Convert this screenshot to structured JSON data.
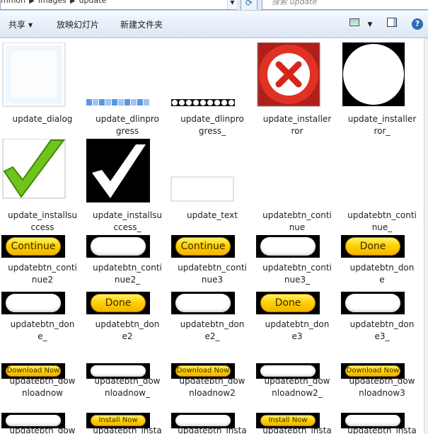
{
  "address": {
    "segments": [
      "mmon",
      "images",
      "update"
    ],
    "search_placeholder": "搜索 update"
  },
  "toolbar": {
    "share_label": "共享",
    "slideshow_label": "放映幻灯片",
    "new_folder_label": "新建文件夹",
    "help_label": "?"
  },
  "files": [
    {
      "name": "update_dialog",
      "thumb": "dialog"
    },
    {
      "name": "update_dlinprogress",
      "thumb": "progress-blue"
    },
    {
      "name": "update_dlinprogress_",
      "thumb": "progress-dots"
    },
    {
      "name": "update_installerror",
      "thumb": "error-red"
    },
    {
      "name": "update_installerror_",
      "thumb": "error-mask"
    },
    {
      "name": "update_installsuccess",
      "thumb": "success-green"
    },
    {
      "name": "update_installsuccess_",
      "thumb": "success-mask"
    },
    {
      "name": "update_text",
      "thumb": "text-box"
    },
    {
      "name": "updatebtn_continue",
      "thumb": "btn-yellow",
      "btn_text": "Continue"
    },
    {
      "name": "updatebtn_continue_",
      "thumb": "btn-white"
    },
    {
      "name": "updatebtn_continue2",
      "thumb": "btn-yellow",
      "btn_text": "Continue"
    },
    {
      "name": "updatebtn_continue2_",
      "thumb": "btn-white"
    },
    {
      "name": "updatebtn_continue3",
      "thumb": "btn-yellow",
      "btn_text": "Continue"
    },
    {
      "name": "updatebtn_continue3_",
      "thumb": "btn-white"
    },
    {
      "name": "updatebtn_done",
      "thumb": "btn-yellow",
      "btn_text": "Done"
    },
    {
      "name": "updatebtn_done_",
      "thumb": "btn-white"
    },
    {
      "name": "updatebtn_done2",
      "thumb": "btn-yellow",
      "btn_text": "Done"
    },
    {
      "name": "updatebtn_done2_",
      "thumb": "btn-white"
    },
    {
      "name": "updatebtn_done3",
      "thumb": "btn-yellow",
      "btn_text": "Done"
    },
    {
      "name": "updatebtn_done3_",
      "thumb": "btn-white"
    },
    {
      "name": "updatebtn_downloadnow",
      "thumb": "btn-yellow-small",
      "btn_text": "Download Now"
    },
    {
      "name": "updatebtn_downloadnow_",
      "thumb": "btn-white-small"
    },
    {
      "name": "updatebtn_downloadnow2",
      "thumb": "btn-yellow-small",
      "btn_text": "Download Now"
    },
    {
      "name": "updatebtn_downloadnow2_",
      "thumb": "btn-white-small"
    },
    {
      "name": "updatebtn_downloadnow3",
      "thumb": "btn-yellow-small",
      "btn_text": "Download Now"
    },
    {
      "name": "updatebtn_dow",
      "thumb": "btn-white-small"
    },
    {
      "name": "updatebtn_insta",
      "thumb": "btn-yellow-small",
      "btn_text": "Install Now"
    },
    {
      "name": "updatebtn_insta",
      "thumb": "btn-white-small"
    },
    {
      "name": "updatebtn_insta",
      "thumb": "btn-yellow-small",
      "btn_text": "Install Now"
    },
    {
      "name": "updatebtn_insta",
      "thumb": "btn-white-small"
    }
  ],
  "label_lines": [
    [
      "update_dialog"
    ],
    [
      "update_dlinpro",
      "gress"
    ],
    [
      "update_dlinpro",
      "gress_"
    ],
    [
      "update_installer",
      "ror"
    ],
    [
      "update_installer",
      "ror_"
    ],
    [
      "update_installsu",
      "ccess"
    ],
    [
      "update_installsu",
      "ccess_"
    ],
    [
      "update_text"
    ],
    [
      "updatebtn_conti",
      "nue"
    ],
    [
      "updatebtn_conti",
      "nue_"
    ],
    [
      "updatebtn_conti",
      "nue2"
    ],
    [
      "updatebtn_conti",
      "nue2_"
    ],
    [
      "updatebtn_conti",
      "nue3"
    ],
    [
      "updatebtn_conti",
      "nue3_"
    ],
    [
      "updatebtn_don",
      "e"
    ],
    [
      "updatebtn_don",
      "e_"
    ],
    [
      "updatebtn_don",
      "e2"
    ],
    [
      "updatebtn_don",
      "e2_"
    ],
    [
      "updatebtn_don",
      "e3"
    ],
    [
      "updatebtn_don",
      "e3_"
    ],
    [
      "updatebtn_dow",
      "nloadnow"
    ],
    [
      "updatebtn_dow",
      "nloadnow_"
    ],
    [
      "updatebtn_dow",
      "nloadnow2"
    ],
    [
      "updatebtn_dow",
      "nloadnow2_"
    ],
    [
      "updatebtn_dow",
      "nloadnow3"
    ],
    [
      "updatebtn_dow"
    ],
    [
      "updatebtn_insta"
    ],
    [
      "updatebtn_insta"
    ],
    [
      "updatebtn_insta"
    ],
    [
      "updatebtn_insta"
    ]
  ]
}
